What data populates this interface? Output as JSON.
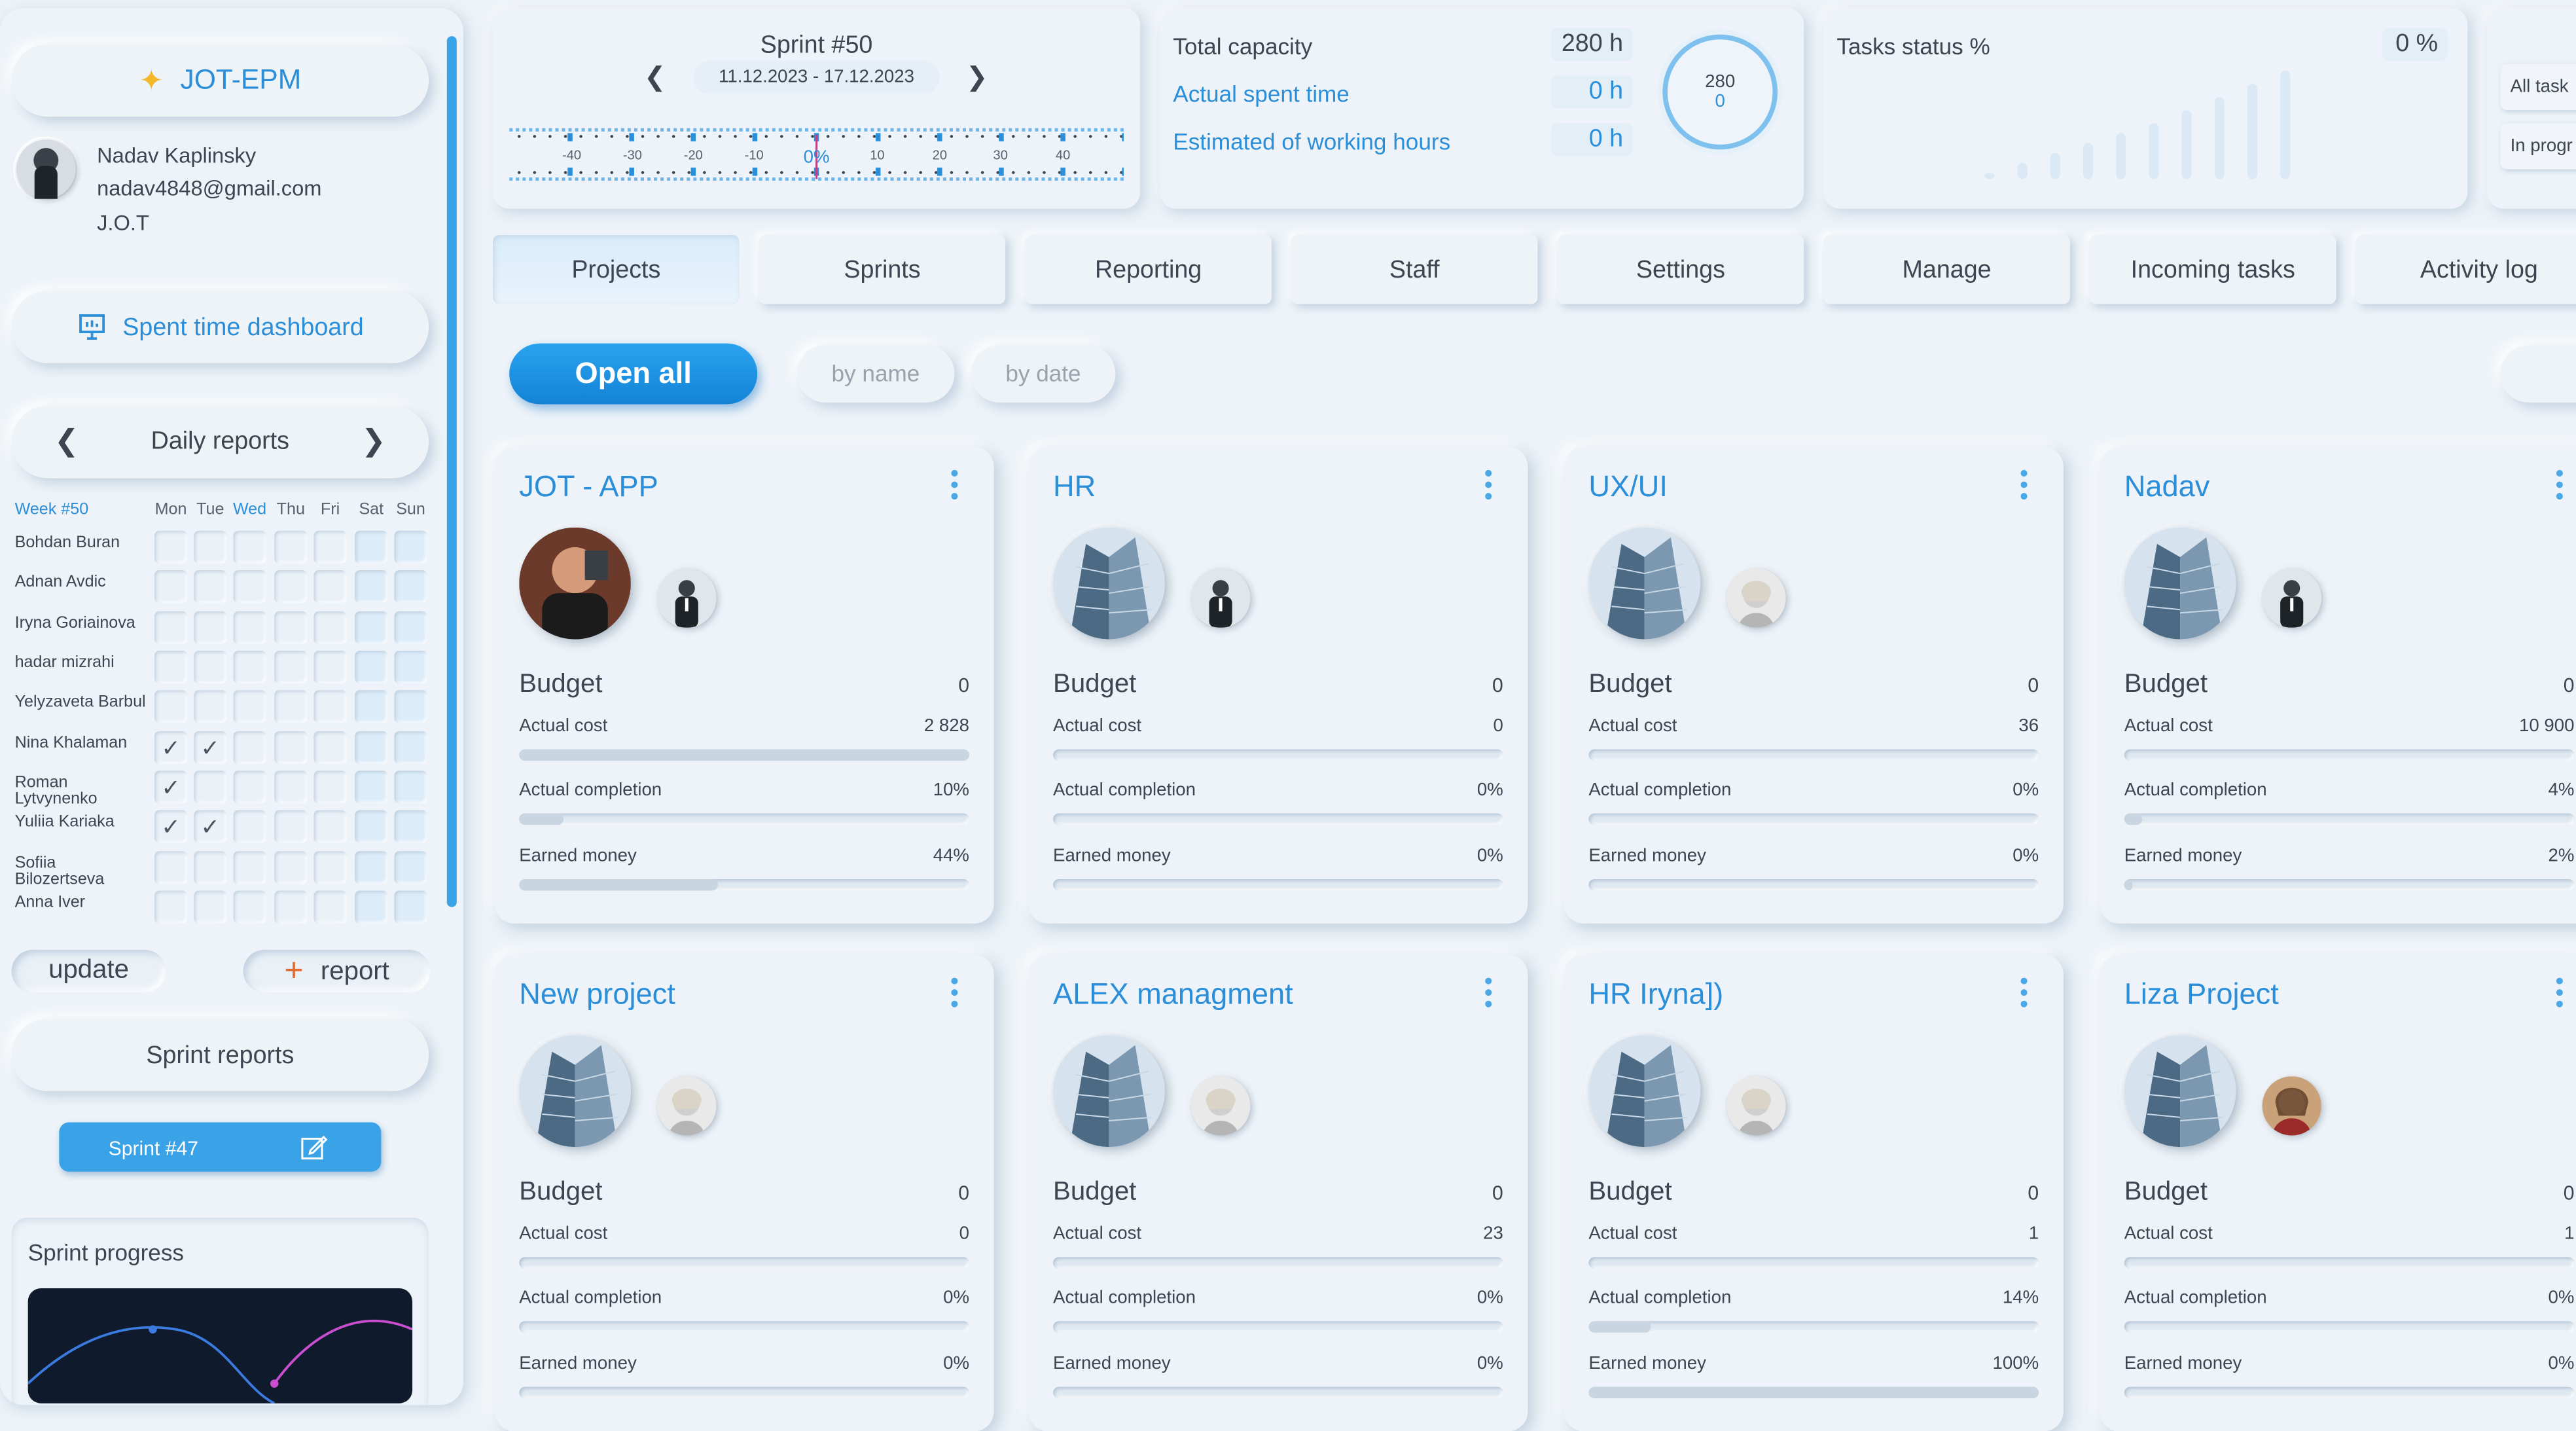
{
  "sidebar": {
    "app_button": "JOT-EPM",
    "user": {
      "name": "Nadav Kaplinsky",
      "email": "nadav4848@gmail.com",
      "org": "J.O.T"
    },
    "spent_time_dashboard": "Spent time dashboard",
    "daily_reports": "Daily reports",
    "week": {
      "label": "Week #50",
      "days": [
        "Mon",
        "Tue",
        "Wed",
        "Thu",
        "Fri",
        "Sat",
        "Sun"
      ],
      "people": [
        {
          "name": "Bohdan Buran",
          "checks": [
            false,
            false,
            false,
            false,
            false,
            false,
            false
          ]
        },
        {
          "name": "Adnan Avdic",
          "checks": [
            false,
            false,
            false,
            false,
            false,
            false,
            false
          ]
        },
        {
          "name": "Iryna Goriainova",
          "checks": [
            false,
            false,
            false,
            false,
            false,
            false,
            false
          ]
        },
        {
          "name": "hadar mizrahi",
          "checks": [
            false,
            false,
            false,
            false,
            false,
            false,
            false
          ]
        },
        {
          "name": "Yelyzaveta Barbul",
          "checks": [
            false,
            false,
            false,
            false,
            false,
            false,
            false
          ]
        },
        {
          "name": "Nina Khalaman",
          "checks": [
            true,
            true,
            false,
            false,
            false,
            false,
            false
          ]
        },
        {
          "name": "Roman Lytvynenko",
          "checks": [
            true,
            false,
            false,
            false,
            false,
            false,
            false
          ]
        },
        {
          "name": "Yuliia Kariaka",
          "checks": [
            true,
            true,
            false,
            false,
            false,
            false,
            false
          ]
        },
        {
          "name": "Sofiia Bilozertseva",
          "checks": [
            false,
            false,
            false,
            false,
            false,
            false,
            false
          ]
        },
        {
          "name": "Anna Iver",
          "checks": [
            false,
            false,
            false,
            false,
            false,
            false,
            false
          ]
        }
      ],
      "check_glyph": "✓"
    },
    "update_button": "update",
    "report_button": "report",
    "sprint_reports": "Sprint reports",
    "sprint_chip": "Sprint #47",
    "sprint_progress": "Sprint progress"
  },
  "sprint_panel": {
    "title": "Sprint #50",
    "dates": "11.12.2023 - 17.12.2023",
    "ticks": [
      "-40",
      "-30",
      "-20",
      "-10",
      "0%",
      "10",
      "20",
      "30",
      "40"
    ]
  },
  "capacity_panel": {
    "total_capacity_label": "Total capacity",
    "total_capacity_value": "280 h",
    "actual_spent_label": "Actual spent time",
    "actual_spent_value": "0 h",
    "estimated_label": "Estimated of working hours",
    "estimated_value": "0 h",
    "gauge_top": "280",
    "gauge_bottom": "0"
  },
  "tasks_panel": {
    "title": "Tasks status %",
    "value": "0 %"
  },
  "filter_panel": {
    "all_tasks": "All task",
    "in_progress": "In progr"
  },
  "tabs": [
    "Projects",
    "Sprints",
    "Reporting",
    "Staff",
    "Settings",
    "Manage",
    "Incoming tasks",
    "Activity log"
  ],
  "toolbar": {
    "open_all": "Open all",
    "by_name": "by name",
    "by_date": "by date"
  },
  "labels": {
    "budget": "Budget",
    "actual_cost": "Actual cost",
    "actual_completion": "Actual completion",
    "earned_money": "Earned money"
  },
  "projects": [
    {
      "name": "JOT - APP",
      "budget": "0",
      "actual_cost": "2 828",
      "completion": "10%",
      "earned": "44%",
      "completion_frac": 0.1,
      "earned_frac": 0.44,
      "cost_frac": 1.0,
      "avatar": "person-photo",
      "member": "man-suit"
    },
    {
      "name": "HR",
      "budget": "0",
      "actual_cost": "0",
      "completion": "0%",
      "earned": "0%",
      "completion_frac": 0,
      "earned_frac": 0,
      "cost_frac": 0,
      "avatar": "building",
      "member": "man-suit"
    },
    {
      "name": "UX/UI",
      "budget": "0",
      "actual_cost": "36",
      "completion": "0%",
      "earned": "0%",
      "completion_frac": 0,
      "earned_frac": 0,
      "cost_frac": 0,
      "avatar": "building",
      "member": "woman-bw"
    },
    {
      "name": "Nadav",
      "budget": "0",
      "actual_cost": "10 900",
      "completion": "4%",
      "earned": "2%",
      "completion_frac": 0.04,
      "earned_frac": 0.02,
      "cost_frac": 0,
      "avatar": "building",
      "member": "man-suit"
    },
    {
      "name": "New project",
      "budget": "0",
      "actual_cost": "0",
      "completion": "0%",
      "earned": "0%",
      "completion_frac": 0,
      "earned_frac": 0,
      "cost_frac": 0,
      "avatar": "building",
      "member": "woman-bw"
    },
    {
      "name": "ALEX managment",
      "budget": "0",
      "actual_cost": "23",
      "completion": "0%",
      "earned": "0%",
      "completion_frac": 0,
      "earned_frac": 0,
      "cost_frac": 0,
      "avatar": "building",
      "member": "woman-bw"
    },
    {
      "name": "HR Iryna])",
      "budget": "0",
      "actual_cost": "1",
      "completion": "14%",
      "earned": "100%",
      "completion_frac": 0.14,
      "earned_frac": 1.0,
      "cost_frac": 0,
      "avatar": "building",
      "member": "woman-bw"
    },
    {
      "name": "Liza Project",
      "budget": "0",
      "actual_cost": "1",
      "completion": "0%",
      "earned": "0%",
      "completion_frac": 0,
      "earned_frac": 0,
      "cost_frac": 0,
      "avatar": "building",
      "member": "woman-red"
    }
  ],
  "colors": {
    "accent": "#2b8ed8",
    "primary_button": "#1e90e0",
    "background": "#edf3f8"
  }
}
